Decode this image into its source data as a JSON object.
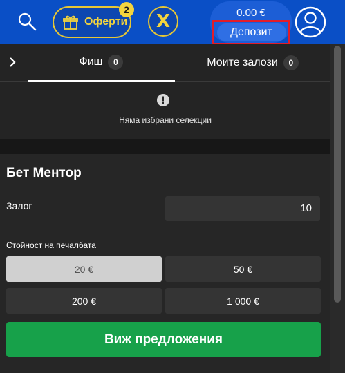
{
  "header": {
    "offers_label": "Оферти",
    "offers_badge": "2",
    "logo_letter": "X",
    "balance": "0.00 €",
    "deposit_label": "Депозит"
  },
  "tabs": [
    {
      "label": "Фиш",
      "count": "0"
    },
    {
      "label": "Моите залози",
      "count": "0"
    }
  ],
  "betslip": {
    "empty_message": "Няма избрани селекции"
  },
  "bet_mentor": {
    "title": "Бет Ментор",
    "stake_label": "Залог",
    "stake_value": "10",
    "winnings_label": "Стойност на печалбата",
    "options": [
      "20 €",
      "50 €",
      "200 €",
      "1 000 €"
    ],
    "selected_option": "20 €",
    "cta_label": "Виж предложения"
  },
  "colors": {
    "header_bg": "#0a4fc6",
    "accent_yellow": "#f3d43e",
    "cta_green": "#17a14a",
    "highlight_red": "#e11d2a"
  }
}
